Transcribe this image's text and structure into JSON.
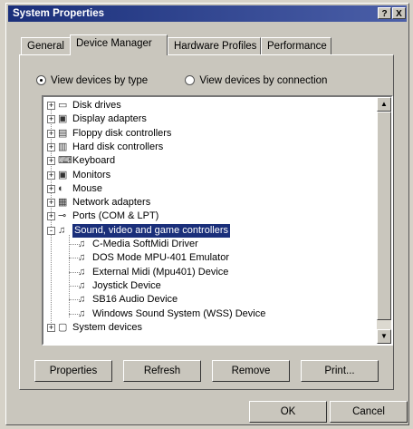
{
  "window": {
    "title": "System Properties",
    "help_btn": "?",
    "close_btn": "X"
  },
  "tabs": [
    {
      "label": "General"
    },
    {
      "label": "Device Manager"
    },
    {
      "label": "Hardware Profiles"
    },
    {
      "label": "Performance"
    }
  ],
  "view_options": {
    "by_type": "View devices by type",
    "by_connection": "View devices by connection"
  },
  "tree": [
    {
      "label": "Disk drives",
      "icon": "disk-drive-icon",
      "level": 0,
      "expander": "+"
    },
    {
      "label": "Display adapters",
      "icon": "monitor-icon",
      "level": 0,
      "expander": "+"
    },
    {
      "label": "Floppy disk controllers",
      "icon": "floppy-icon",
      "level": 0,
      "expander": "+"
    },
    {
      "label": "Hard disk controllers",
      "icon": "hdd-controller-icon",
      "level": 0,
      "expander": "+"
    },
    {
      "label": "Keyboard",
      "icon": "keyboard-icon",
      "level": 0,
      "expander": "+"
    },
    {
      "label": "Monitors",
      "icon": "monitor-icon",
      "level": 0,
      "expander": "+"
    },
    {
      "label": "Mouse",
      "icon": "mouse-icon",
      "level": 0,
      "expander": "+"
    },
    {
      "label": "Network adapters",
      "icon": "network-card-icon",
      "level": 0,
      "expander": "+"
    },
    {
      "label": "Ports (COM & LPT)",
      "icon": "port-icon",
      "level": 0,
      "expander": "+"
    },
    {
      "label": "Sound, video and game controllers",
      "icon": "sound-device-icon",
      "level": 0,
      "expander": "-",
      "selected": true
    },
    {
      "label": "C-Media SoftMidi Driver",
      "icon": "sound-device-icon",
      "level": 1
    },
    {
      "label": "DOS Mode MPU-401 Emulator",
      "icon": "sound-device-icon",
      "level": 1
    },
    {
      "label": "External Midi (Mpu401) Device",
      "icon": "sound-device-icon",
      "level": 1
    },
    {
      "label": "Joystick Device",
      "icon": "sound-device-icon",
      "level": 1
    },
    {
      "label": "SB16 Audio Device",
      "icon": "sound-device-icon",
      "level": 1
    },
    {
      "label": "Windows Sound System (WSS) Device",
      "icon": "sound-device-icon",
      "level": 1
    },
    {
      "label": "System devices",
      "icon": "computer-icon",
      "level": 0,
      "expander": "+"
    }
  ],
  "actions": {
    "properties": "Properties",
    "refresh": "Refresh",
    "remove": "Remove",
    "print": "Print..."
  },
  "dialog": {
    "ok": "OK",
    "cancel": "Cancel"
  },
  "colors": {
    "title_bar": "#1a2f7a",
    "selection": "#1a2f7a",
    "face": "#c9c6bd"
  }
}
